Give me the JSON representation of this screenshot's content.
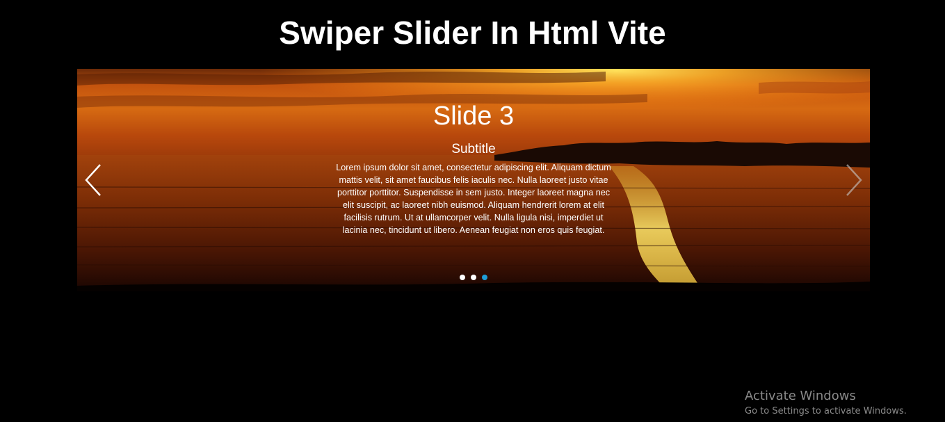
{
  "page": {
    "title": "Swiper Slider In Html Vite"
  },
  "slider": {
    "active_slide": {
      "title": "Slide 3",
      "subtitle": "Subtitle",
      "text": "Lorem ipsum dolor sit amet, consectetur adipiscing elit. Aliquam dictum mattis velit, sit amet faucibus felis iaculis nec. Nulla laoreet justo vitae porttitor porttitor. Suspendisse in sem justo. Integer laoreet magna nec elit suscipit, ac laoreet nibh euismod. Aliquam hendrerit lorem at elit facilisis rutrum. Ut at ullamcorper velit. Nulla ligula nisi, imperdiet ut lacinia nec, tincidunt ut libero. Aenean feugiat non eros quis feugiat.",
      "background": "sunset-over-sea-image"
    },
    "prev_icon": "chevron-left-icon",
    "next_icon": "chevron-right-icon",
    "pagination": {
      "total": 3,
      "active_index": 3
    },
    "colors": {
      "active_bullet": "#1e9ed8",
      "bullet": "#ffffff",
      "next_arrow": "#c8c8c8"
    }
  },
  "watermark": {
    "title": "Activate Windows",
    "subtitle": "Go to Settings to activate Windows."
  }
}
